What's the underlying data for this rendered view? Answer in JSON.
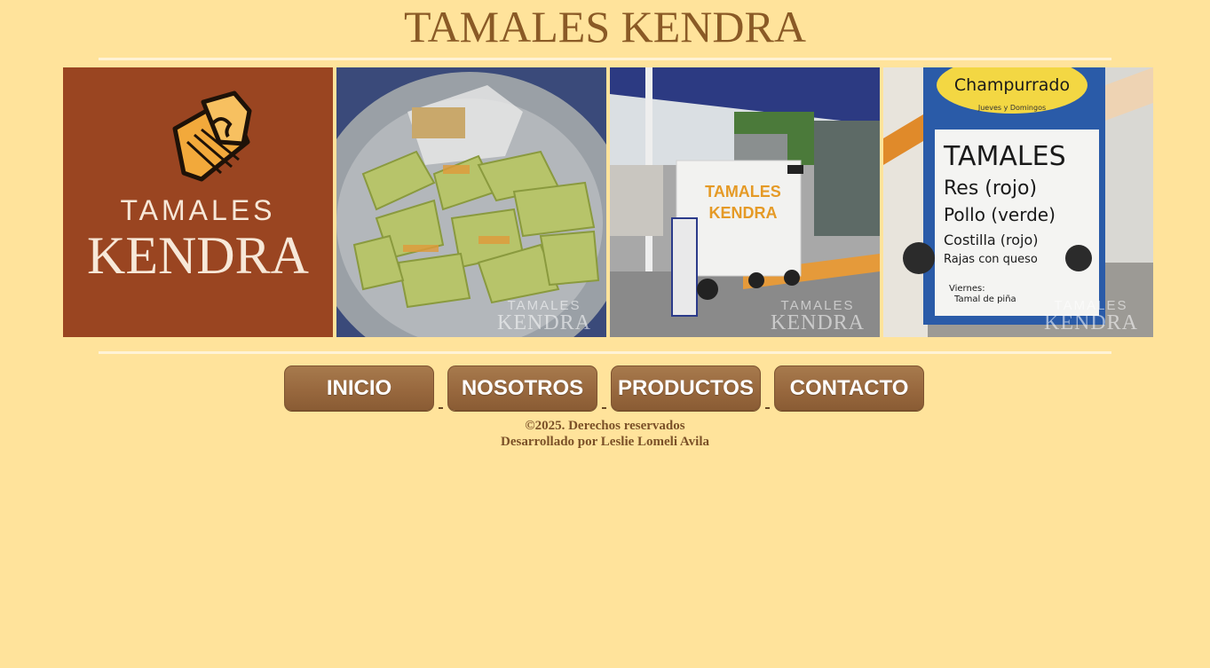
{
  "header": {
    "title": "TAMALES KENDRA"
  },
  "gallery": {
    "logo_top": "TAMALES",
    "logo_bottom": "KENDRA",
    "watermark_top": "TAMALES",
    "watermark_bottom": "KENDRA",
    "cart_sign_line1": "TAMALES",
    "cart_sign_line2": "KENDRA",
    "menu_board": {
      "header": "Champurrado",
      "subheader": "Jueves y Domingos",
      "title": "TAMALES",
      "items": [
        "Res (rojo)",
        "Pollo (verde)",
        "Costilla (rojo)",
        "Rajas con queso"
      ],
      "note_1": "Viernes:",
      "note_2": "Tamal de piña"
    }
  },
  "nav": {
    "items": [
      "INICIO",
      "NOSOTROS",
      "PRODUCTOS",
      "CONTACTO"
    ]
  },
  "footer": {
    "copyright": "©2025. Derechos reservados",
    "credit": "Desarrollado por Leslie Lomeli Avila"
  },
  "colors": {
    "background": "#ffe39b",
    "title": "#8a5a26",
    "button": "#98683e",
    "logo_bg": "#9a4521"
  }
}
